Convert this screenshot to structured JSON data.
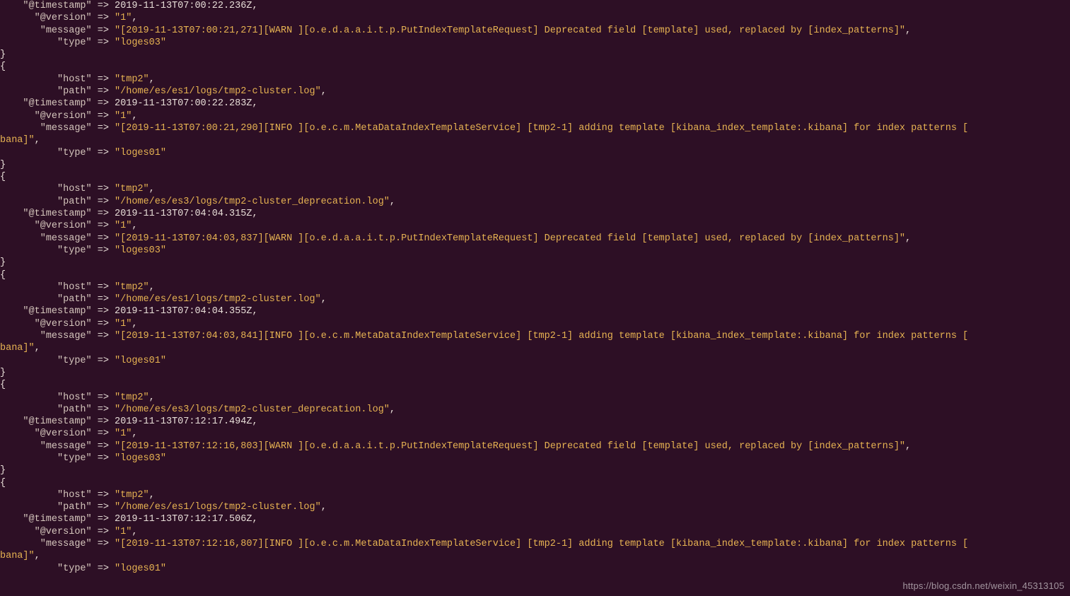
{
  "watermark": "https://blog.csdn.net/weixin_45313105",
  "blocks": [
    {
      "prefix": "partial0",
      "rows": [
        {
          "key": "\"@timestamp\"",
          "val": "2019-11-13T07:00:22.236Z,",
          "str": false,
          "pad": 4
        },
        {
          "key": "\"@version\"",
          "val": "\"1\"",
          "str": true,
          "comma": true,
          "pad": 6
        },
        {
          "key": "\"message\"",
          "val": "\"[2019-11-13T07:00:21,271][WARN ][o.e.d.a.a.i.t.p.PutIndexTemplateRequest] Deprecated field [template] used, replaced by [index_patterns]\"",
          "str": true,
          "comma": true,
          "pad": 7
        },
        {
          "key": "\"type\"",
          "val": "\"loges03\"",
          "str": true,
          "comma": false,
          "pad": 10
        }
      ]
    },
    {
      "rows": [
        {
          "key": "\"host\"",
          "val": "\"tmp2\"",
          "str": true,
          "comma": true,
          "pad": 10
        },
        {
          "key": "\"path\"",
          "val": "\"/home/es/es1/logs/tmp2-cluster.log\"",
          "str": true,
          "comma": true,
          "pad": 10
        },
        {
          "key": "\"@timestamp\"",
          "val": "2019-11-13T07:00:22.283Z,",
          "str": false,
          "pad": 4
        },
        {
          "key": "\"@version\"",
          "val": "\"1\"",
          "str": true,
          "comma": true,
          "pad": 6
        },
        {
          "key": "\"message\"",
          "val": "\"[2019-11-13T07:00:21,290][INFO ][o.e.c.m.MetaDataIndexTemplateService] [tmp2-1] adding template [kibana_index_template:.kibana] for index patterns [",
          "str": true,
          "wrapSuffix": "bana]\",",
          "pad": 7
        },
        {
          "key": "\"type\"",
          "val": "\"loges01\"",
          "str": true,
          "comma": false,
          "pad": 10
        }
      ]
    },
    {
      "rows": [
        {
          "key": "\"host\"",
          "val": "\"tmp2\"",
          "str": true,
          "comma": true,
          "pad": 10
        },
        {
          "key": "\"path\"",
          "val": "\"/home/es/es3/logs/tmp2-cluster_deprecation.log\"",
          "str": true,
          "comma": true,
          "pad": 10
        },
        {
          "key": "\"@timestamp\"",
          "val": "2019-11-13T07:04:04.315Z,",
          "str": false,
          "pad": 4
        },
        {
          "key": "\"@version\"",
          "val": "\"1\"",
          "str": true,
          "comma": true,
          "pad": 6
        },
        {
          "key": "\"message\"",
          "val": "\"[2019-11-13T07:04:03,837][WARN ][o.e.d.a.a.i.t.p.PutIndexTemplateRequest] Deprecated field [template] used, replaced by [index_patterns]\"",
          "str": true,
          "comma": true,
          "pad": 7
        },
        {
          "key": "\"type\"",
          "val": "\"loges03\"",
          "str": true,
          "comma": false,
          "pad": 10
        }
      ]
    },
    {
      "rows": [
        {
          "key": "\"host\"",
          "val": "\"tmp2\"",
          "str": true,
          "comma": true,
          "pad": 10
        },
        {
          "key": "\"path\"",
          "val": "\"/home/es/es1/logs/tmp2-cluster.log\"",
          "str": true,
          "comma": true,
          "pad": 10
        },
        {
          "key": "\"@timestamp\"",
          "val": "2019-11-13T07:04:04.355Z,",
          "str": false,
          "pad": 4
        },
        {
          "key": "\"@version\"",
          "val": "\"1\"",
          "str": true,
          "comma": true,
          "pad": 6
        },
        {
          "key": "\"message\"",
          "val": "\"[2019-11-13T07:04:03,841][INFO ][o.e.c.m.MetaDataIndexTemplateService] [tmp2-1] adding template [kibana_index_template:.kibana] for index patterns [",
          "str": true,
          "wrapSuffix": "bana]\",",
          "pad": 7
        },
        {
          "key": "\"type\"",
          "val": "\"loges01\"",
          "str": true,
          "comma": false,
          "pad": 10
        }
      ]
    },
    {
      "rows": [
        {
          "key": "\"host\"",
          "val": "\"tmp2\"",
          "str": true,
          "comma": true,
          "pad": 10
        },
        {
          "key": "\"path\"",
          "val": "\"/home/es/es3/logs/tmp2-cluster_deprecation.log\"",
          "str": true,
          "comma": true,
          "pad": 10
        },
        {
          "key": "\"@timestamp\"",
          "val": "2019-11-13T07:12:17.494Z,",
          "str": false,
          "pad": 4
        },
        {
          "key": "\"@version\"",
          "val": "\"1\"",
          "str": true,
          "comma": true,
          "pad": 6
        },
        {
          "key": "\"message\"",
          "val": "\"[2019-11-13T07:12:16,803][WARN ][o.e.d.a.a.i.t.p.PutIndexTemplateRequest] Deprecated field [template] used, replaced by [index_patterns]\"",
          "str": true,
          "comma": true,
          "pad": 7
        },
        {
          "key": "\"type\"",
          "val": "\"loges03\"",
          "str": true,
          "comma": false,
          "pad": 10
        }
      ]
    },
    {
      "rows": [
        {
          "key": "\"host\"",
          "val": "\"tmp2\"",
          "str": true,
          "comma": true,
          "pad": 10
        },
        {
          "key": "\"path\"",
          "val": "\"/home/es/es1/logs/tmp2-cluster.log\"",
          "str": true,
          "comma": true,
          "pad": 10
        },
        {
          "key": "\"@timestamp\"",
          "val": "2019-11-13T07:12:17.506Z,",
          "str": false,
          "pad": 4
        },
        {
          "key": "\"@version\"",
          "val": "\"1\"",
          "str": true,
          "comma": true,
          "pad": 6
        },
        {
          "key": "\"message\"",
          "val": "\"[2019-11-13T07:12:16,807][INFO ][o.e.c.m.MetaDataIndexTemplateService] [tmp2-1] adding template [kibana_index_template:.kibana] for index patterns [",
          "str": true,
          "wrapSuffix": "bana]\",",
          "pad": 7
        },
        {
          "key": "\"type\"",
          "val": "\"loges01\"",
          "str": true,
          "comma": false,
          "pad": 10
        }
      ],
      "noClose": true
    }
  ]
}
